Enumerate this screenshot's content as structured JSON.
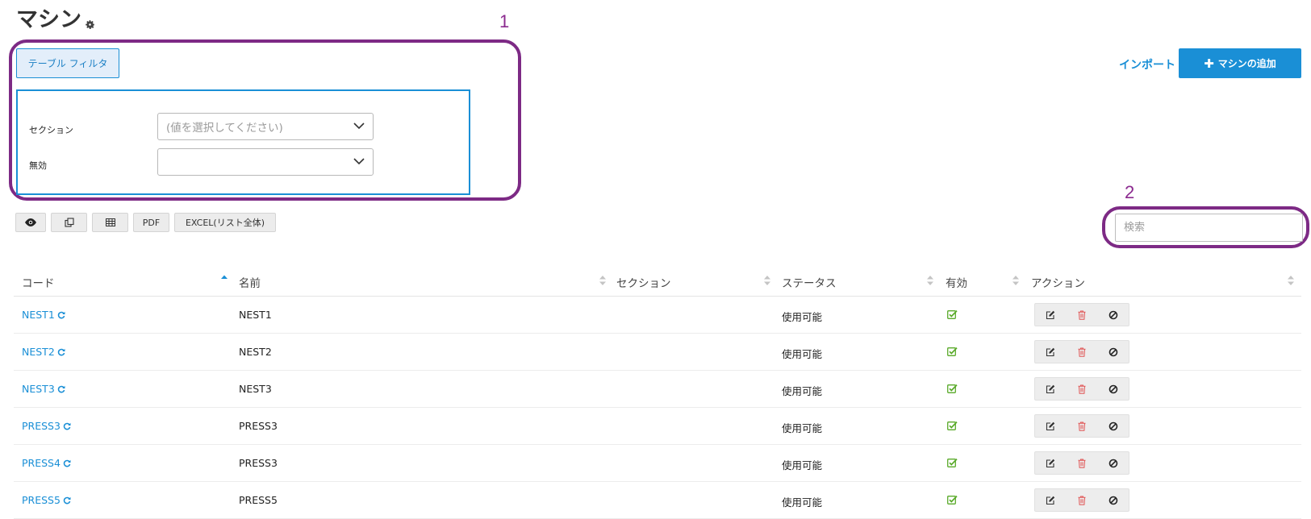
{
  "page": {
    "title": "マシン"
  },
  "annotations": {
    "one": "1",
    "two": "2"
  },
  "filter": {
    "toggle_label": "テーブル フィルタ",
    "section_label": "セクション",
    "section_placeholder": "(値を選択してください)",
    "disabled_label": "無効",
    "disabled_value": ""
  },
  "header_actions": {
    "import_label": "インポート",
    "add_label": "マシンの追加"
  },
  "toolbar": {
    "pdf_label": "PDF",
    "excel_label": "EXCEL(リスト全体)"
  },
  "search": {
    "placeholder": "検索"
  },
  "table": {
    "columns": [
      "コード",
      "名前",
      "セクション",
      "ステータス",
      "有効",
      "アクション"
    ],
    "rows": [
      {
        "code": "NEST1",
        "name": "NEST1",
        "section": "",
        "status": "使用可能",
        "enabled": true
      },
      {
        "code": "NEST2",
        "name": "NEST2",
        "section": "",
        "status": "使用可能",
        "enabled": true
      },
      {
        "code": "NEST3",
        "name": "NEST3",
        "section": "",
        "status": "使用可能",
        "enabled": true
      },
      {
        "code": "PRESS3",
        "name": "PRESS3",
        "section": "",
        "status": "使用可能",
        "enabled": true
      },
      {
        "code": "PRESS4",
        "name": "PRESS3",
        "section": "",
        "status": "使用可能",
        "enabled": true
      },
      {
        "code": "PRESS5",
        "name": "PRESS5",
        "section": "",
        "status": "使用可能",
        "enabled": true
      }
    ]
  },
  "colors": {
    "accent": "#1a8fd6",
    "annotation": "#7d2a85",
    "check": "#5aaa2a",
    "delete": "#e05555"
  }
}
